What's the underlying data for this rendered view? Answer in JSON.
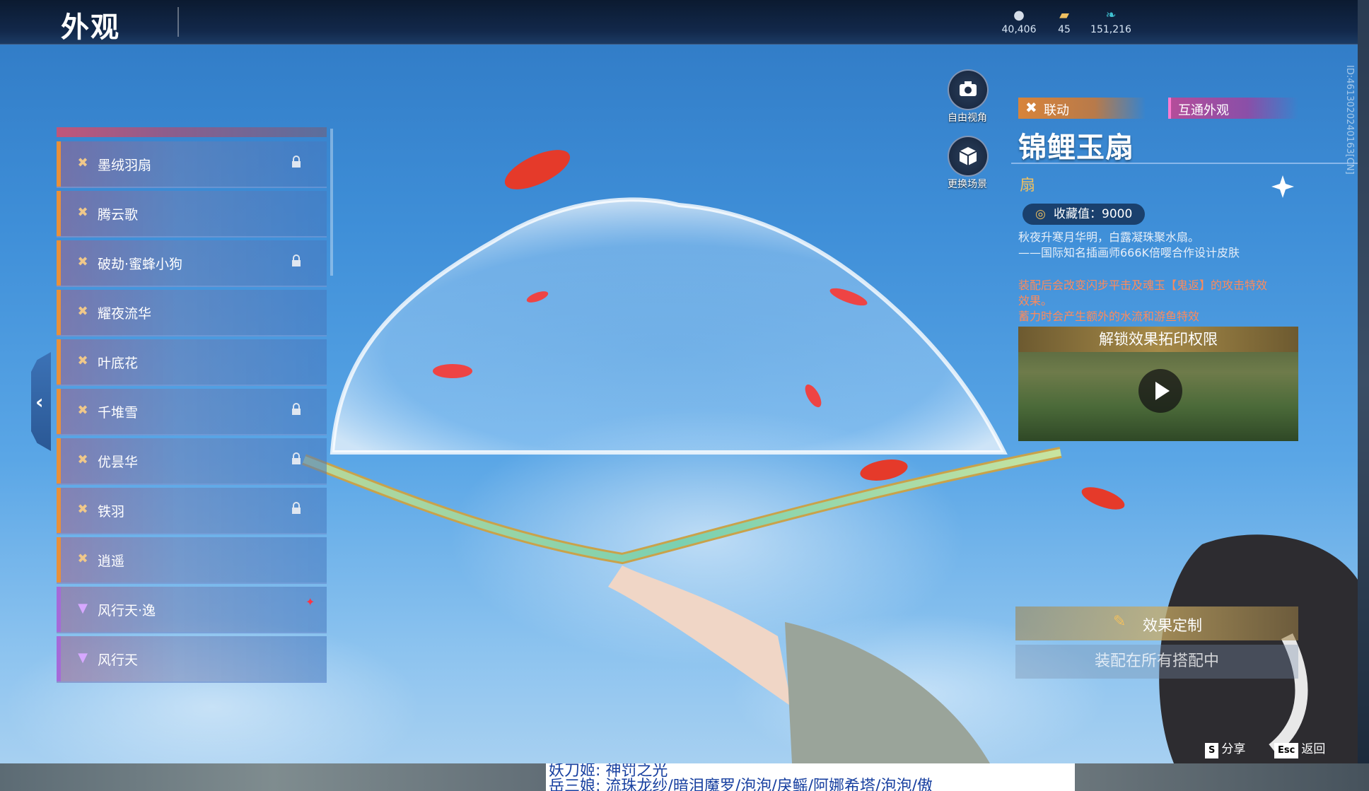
{
  "header": {
    "title": "外观",
    "currencies": [
      {
        "icon": "coin-icon",
        "value": "40,406"
      },
      {
        "icon": "ticket-icon",
        "value": "45"
      },
      {
        "icon": "feather-icon",
        "value": "151,216"
      }
    ]
  },
  "list": {
    "items": [
      {
        "label": "墨绒羽扇",
        "locked": true,
        "rarity": "orange"
      },
      {
        "label": "腾云歌",
        "locked": false,
        "rarity": "orange"
      },
      {
        "label": "破劫·蜜蜂小狗",
        "locked": true,
        "rarity": "orange"
      },
      {
        "label": "耀夜流华",
        "locked": false,
        "rarity": "orange"
      },
      {
        "label": "叶底花",
        "locked": false,
        "rarity": "orange"
      },
      {
        "label": "千堆雪",
        "locked": true,
        "rarity": "orange"
      },
      {
        "label": "优昙华",
        "locked": true,
        "rarity": "orange"
      },
      {
        "label": "铁羽",
        "locked": true,
        "rarity": "orange"
      },
      {
        "label": "逍遥",
        "locked": false,
        "rarity": "orange"
      },
      {
        "label": "风行天·逸",
        "locked": false,
        "rarity": "purple",
        "new": true
      },
      {
        "label": "风行天",
        "locked": false,
        "rarity": "purple"
      }
    ]
  },
  "camera": {
    "free_view": "自由视角",
    "change_scene": "更换场景"
  },
  "detail": {
    "tag_collab": "联动",
    "tag_shared": "互通外观",
    "name": "锦鲤玉扇",
    "type": "扇",
    "collection": "收藏值：9000",
    "desc_lines": [
      "秋夜升寒月华明，白露凝珠聚水扇。",
      "——国际知名插画师666K倍嘤合作设计皮肤"
    ],
    "effect_lines": [
      "装配后会改变闪步平击及魂玉【鬼返】的攻击特效",
      "效果。",
      "蓄力时会产生额外的水流和游鱼特效"
    ],
    "video_title": "解锁效果拓印权限",
    "custom_btn": "效果定制",
    "equip_btn": "装配在所有搭配中",
    "side_id": "ID:4613020240163[CN]"
  },
  "footer": {
    "share_key": "S",
    "share_label": "分享",
    "back_key": "Esc",
    "back_label": "返回"
  },
  "chat": {
    "line1": "妖刀姬: 神罚之光",
    "line2": "岳三娘: 流珠龙纱/暗泪魔罗/泡泡/戾鳐/阿娜希塔/泡泡/傲"
  },
  "colors": {
    "accent_orange": "#e8903a",
    "accent_purple": "#a56ad8",
    "effect_text": "#ff8a5a",
    "gold": "#f0c060"
  }
}
